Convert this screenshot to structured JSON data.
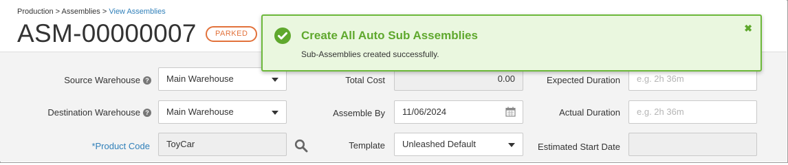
{
  "breadcrumb": {
    "items": [
      "Production",
      "Assemblies",
      "View Assemblies"
    ],
    "separator": ">"
  },
  "title": "ASM-00000007",
  "status_badge": "PARKED",
  "toast": {
    "title": "Create All Auto Sub Assemblies",
    "message": "Sub-Assemblies created successfully.",
    "close_icon": "close-icon",
    "check_icon": "check-circle-icon"
  },
  "form": {
    "source_warehouse": {
      "label": "Source Warehouse",
      "value": "Main Warehouse"
    },
    "destination_warehouse": {
      "label": "Destination Warehouse",
      "value": "Main Warehouse"
    },
    "product_code": {
      "label": "*Product Code",
      "value": "ToyCar"
    },
    "total_cost": {
      "label": "Total Cost",
      "value": "0.00"
    },
    "assemble_by": {
      "label": "Assemble By",
      "value": "11/06/2024"
    },
    "template": {
      "label": "Template",
      "value": "Unleashed Default"
    },
    "expected_duration": {
      "label": "Expected Duration",
      "placeholder": "e.g. 2h 36m"
    },
    "actual_duration": {
      "label": "Actual Duration",
      "placeholder": "e.g. 2h 36m"
    },
    "estimated_start_date": {
      "label": "Estimated Start Date",
      "value": ""
    }
  },
  "colors": {
    "link": "#2f7fb9",
    "badge": "#e2713a",
    "success": "#5fa82d",
    "success_bg": "#eaf7df"
  }
}
